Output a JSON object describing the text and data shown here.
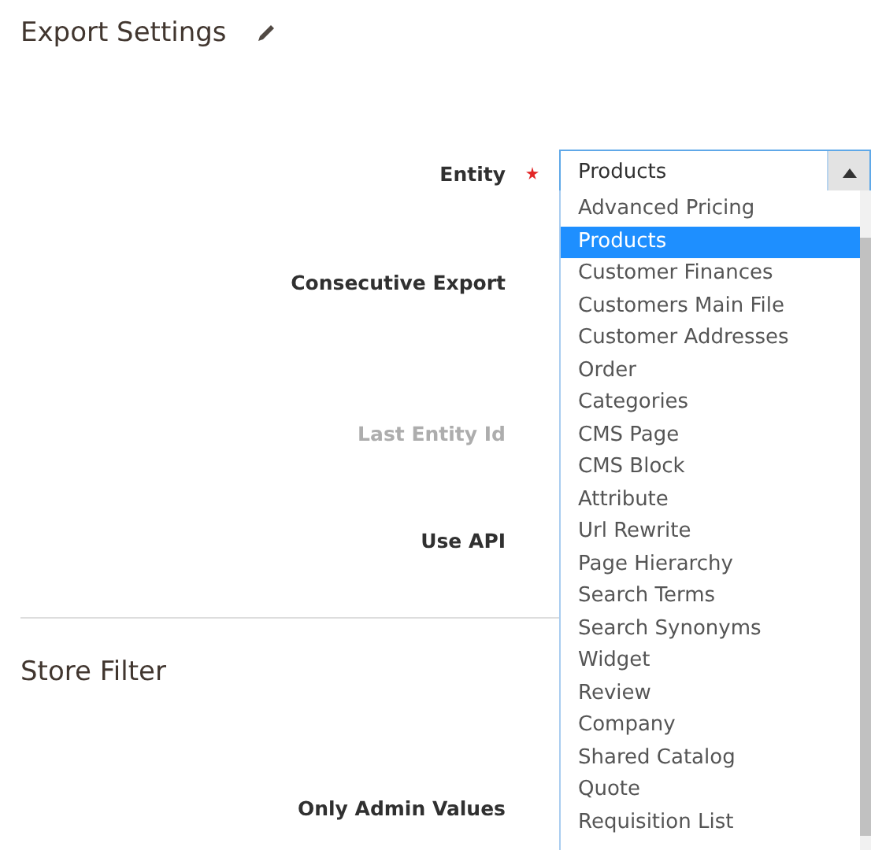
{
  "header": {
    "title": "Export Settings"
  },
  "fields": [
    {
      "label": "Entity",
      "required": true,
      "disabled": false
    },
    {
      "label": "Consecutive Export",
      "required": false,
      "disabled": false
    },
    {
      "label": "Last Entity Id",
      "required": false,
      "disabled": true
    },
    {
      "label": "Use API",
      "required": false,
      "disabled": false
    }
  ],
  "entity_select": {
    "value": "Products",
    "expanded": true,
    "options": [
      {
        "label": "Advanced Pricing",
        "selected": false
      },
      {
        "label": "Products",
        "selected": true
      },
      {
        "label": "Customer Finances",
        "selected": false
      },
      {
        "label": "Customers Main File",
        "selected": false
      },
      {
        "label": "Customer Addresses",
        "selected": false
      },
      {
        "label": "Order",
        "selected": false
      },
      {
        "label": "Categories",
        "selected": false
      },
      {
        "label": "CMS Page",
        "selected": false
      },
      {
        "label": "CMS Block",
        "selected": false
      },
      {
        "label": "Attribute",
        "selected": false
      },
      {
        "label": "Url Rewrite",
        "selected": false
      },
      {
        "label": "Page Hierarchy",
        "selected": false
      },
      {
        "label": "Search Terms",
        "selected": false
      },
      {
        "label": "Search Synonyms",
        "selected": false
      },
      {
        "label": "Widget",
        "selected": false
      },
      {
        "label": "Review",
        "selected": false
      },
      {
        "label": "Company",
        "selected": false
      },
      {
        "label": "Shared Catalog",
        "selected": false
      },
      {
        "label": "Quote",
        "selected": false
      },
      {
        "label": "Requisition List",
        "selected": false
      }
    ]
  },
  "store_filter": {
    "title": "Store Filter",
    "fields": [
      {
        "label": "Only Admin Values",
        "disabled": false
      }
    ]
  }
}
